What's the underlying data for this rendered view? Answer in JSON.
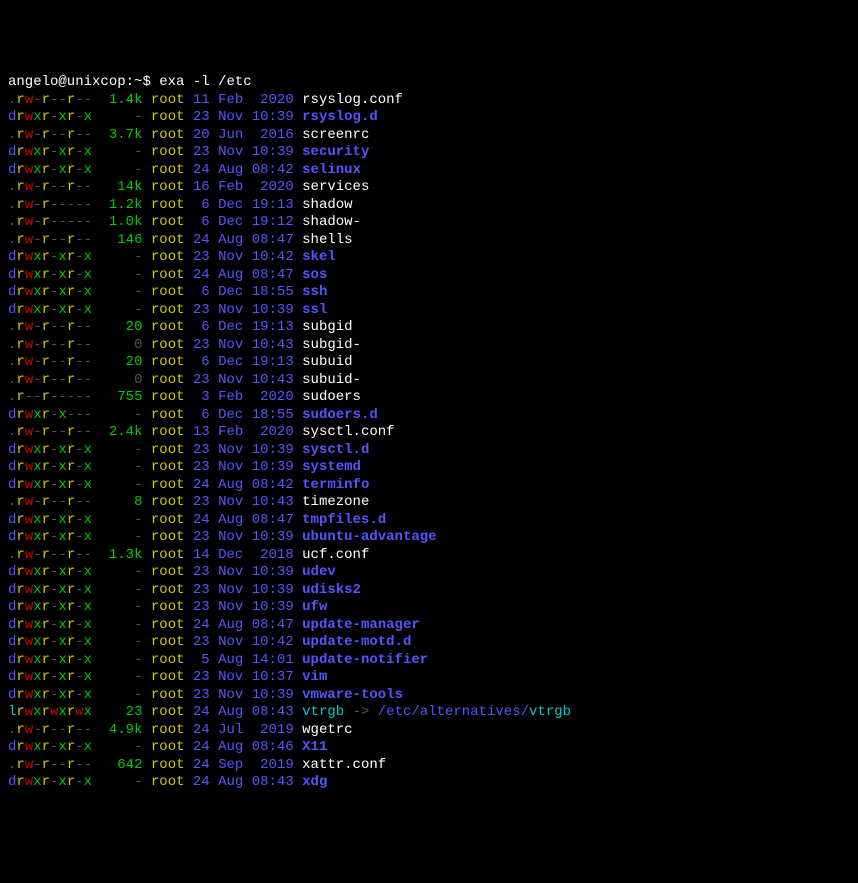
{
  "prompt": {
    "userhost": "angelo@unixcop",
    "path": "~",
    "command": "exa -l /etc"
  },
  "rows": [
    {
      "perm": ".rw-r--r--",
      "size": "1.4k",
      "user": "root",
      "day": "11",
      "mon": "Feb",
      "time": "2020",
      "name": "rsyslog.conf",
      "type": "file"
    },
    {
      "perm": "drwxr-xr-x",
      "size": "-",
      "user": "root",
      "day": "23",
      "mon": "Nov",
      "time": "10:39",
      "name": "rsyslog.d",
      "type": "dir"
    },
    {
      "perm": ".rw-r--r--",
      "size": "3.7k",
      "user": "root",
      "day": "20",
      "mon": "Jun",
      "time": "2016",
      "name": "screenrc",
      "type": "file"
    },
    {
      "perm": "drwxr-xr-x",
      "size": "-",
      "user": "root",
      "day": "23",
      "mon": "Nov",
      "time": "10:39",
      "name": "security",
      "type": "dir"
    },
    {
      "perm": "drwxr-xr-x",
      "size": "-",
      "user": "root",
      "day": "24",
      "mon": "Aug",
      "time": "08:42",
      "name": "selinux",
      "type": "dir"
    },
    {
      "perm": ".rw-r--r--",
      "size": "14k",
      "user": "root",
      "day": "16",
      "mon": "Feb",
      "time": "2020",
      "name": "services",
      "type": "file"
    },
    {
      "perm": ".rw-r-----",
      "size": "1.2k",
      "user": "root",
      "day": "6",
      "mon": "Dec",
      "time": "19:13",
      "name": "shadow",
      "type": "file"
    },
    {
      "perm": ".rw-r-----",
      "size": "1.0k",
      "user": "root",
      "day": "6",
      "mon": "Dec",
      "time": "19:12",
      "name": "shadow-",
      "type": "file"
    },
    {
      "perm": ".rw-r--r--",
      "size": "146",
      "user": "root",
      "day": "24",
      "mon": "Aug",
      "time": "08:47",
      "name": "shells",
      "type": "file"
    },
    {
      "perm": "drwxr-xr-x",
      "size": "-",
      "user": "root",
      "day": "23",
      "mon": "Nov",
      "time": "10:42",
      "name": "skel",
      "type": "dir"
    },
    {
      "perm": "drwxr-xr-x",
      "size": "-",
      "user": "root",
      "day": "24",
      "mon": "Aug",
      "time": "08:47",
      "name": "sos",
      "type": "dir"
    },
    {
      "perm": "drwxr-xr-x",
      "size": "-",
      "user": "root",
      "day": "6",
      "mon": "Dec",
      "time": "18:55",
      "name": "ssh",
      "type": "dir"
    },
    {
      "perm": "drwxr-xr-x",
      "size": "-",
      "user": "root",
      "day": "23",
      "mon": "Nov",
      "time": "10:39",
      "name": "ssl",
      "type": "dir"
    },
    {
      "perm": ".rw-r--r--",
      "size": "20",
      "user": "root",
      "day": "6",
      "mon": "Dec",
      "time": "19:13",
      "name": "subgid",
      "type": "file"
    },
    {
      "perm": ".rw-r--r--",
      "size": "0",
      "user": "root",
      "day": "23",
      "mon": "Nov",
      "time": "10:43",
      "name": "subgid-",
      "type": "file"
    },
    {
      "perm": ".rw-r--r--",
      "size": "20",
      "user": "root",
      "day": "6",
      "mon": "Dec",
      "time": "19:13",
      "name": "subuid",
      "type": "file"
    },
    {
      "perm": ".rw-r--r--",
      "size": "0",
      "user": "root",
      "day": "23",
      "mon": "Nov",
      "time": "10:43",
      "name": "subuid-",
      "type": "file"
    },
    {
      "perm": ".r--r-----",
      "size": "755",
      "user": "root",
      "day": "3",
      "mon": "Feb",
      "time": "2020",
      "name": "sudoers",
      "type": "file"
    },
    {
      "perm": "drwxr-x---",
      "size": "-",
      "user": "root",
      "day": "6",
      "mon": "Dec",
      "time": "18:55",
      "name": "sudoers.d",
      "type": "dir"
    },
    {
      "perm": ".rw-r--r--",
      "size": "2.4k",
      "user": "root",
      "day": "13",
      "mon": "Feb",
      "time": "2020",
      "name": "sysctl.conf",
      "type": "file"
    },
    {
      "perm": "drwxr-xr-x",
      "size": "-",
      "user": "root",
      "day": "23",
      "mon": "Nov",
      "time": "10:39",
      "name": "sysctl.d",
      "type": "dir"
    },
    {
      "perm": "drwxr-xr-x",
      "size": "-",
      "user": "root",
      "day": "23",
      "mon": "Nov",
      "time": "10:39",
      "name": "systemd",
      "type": "dir"
    },
    {
      "perm": "drwxr-xr-x",
      "size": "-",
      "user": "root",
      "day": "24",
      "mon": "Aug",
      "time": "08:42",
      "name": "terminfo",
      "type": "dir"
    },
    {
      "perm": ".rw-r--r--",
      "size": "8",
      "user": "root",
      "day": "23",
      "mon": "Nov",
      "time": "10:43",
      "name": "timezone",
      "type": "file"
    },
    {
      "perm": "drwxr-xr-x",
      "size": "-",
      "user": "root",
      "day": "24",
      "mon": "Aug",
      "time": "08:47",
      "name": "tmpfiles.d",
      "type": "dir"
    },
    {
      "perm": "drwxr-xr-x",
      "size": "-",
      "user": "root",
      "day": "23",
      "mon": "Nov",
      "time": "10:39",
      "name": "ubuntu-advantage",
      "type": "dir"
    },
    {
      "perm": ".rw-r--r--",
      "size": "1.3k",
      "user": "root",
      "day": "14",
      "mon": "Dec",
      "time": "2018",
      "name": "ucf.conf",
      "type": "file"
    },
    {
      "perm": "drwxr-xr-x",
      "size": "-",
      "user": "root",
      "day": "23",
      "mon": "Nov",
      "time": "10:39",
      "name": "udev",
      "type": "dir"
    },
    {
      "perm": "drwxr-xr-x",
      "size": "-",
      "user": "root",
      "day": "23",
      "mon": "Nov",
      "time": "10:39",
      "name": "udisks2",
      "type": "dir"
    },
    {
      "perm": "drwxr-xr-x",
      "size": "-",
      "user": "root",
      "day": "23",
      "mon": "Nov",
      "time": "10:39",
      "name": "ufw",
      "type": "dir"
    },
    {
      "perm": "drwxr-xr-x",
      "size": "-",
      "user": "root",
      "day": "24",
      "mon": "Aug",
      "time": "08:47",
      "name": "update-manager",
      "type": "dir"
    },
    {
      "perm": "drwxr-xr-x",
      "size": "-",
      "user": "root",
      "day": "23",
      "mon": "Nov",
      "time": "10:42",
      "name": "update-motd.d",
      "type": "dir"
    },
    {
      "perm": "drwxr-xr-x",
      "size": "-",
      "user": "root",
      "day": "5",
      "mon": "Aug",
      "time": "14:01",
      "name": "update-notifier",
      "type": "dir"
    },
    {
      "perm": "drwxr-xr-x",
      "size": "-",
      "user": "root",
      "day": "23",
      "mon": "Nov",
      "time": "10:37",
      "name": "vim",
      "type": "dir"
    },
    {
      "perm": "drwxr-xr-x",
      "size": "-",
      "user": "root",
      "day": "23",
      "mon": "Nov",
      "time": "10:39",
      "name": "vmware-tools",
      "type": "dir"
    },
    {
      "perm": "lrwxrwxrwx",
      "size": "23",
      "user": "root",
      "day": "24",
      "mon": "Aug",
      "time": "08:43",
      "name": "vtrgb",
      "type": "link",
      "link": "/etc/alternatives/vtrgb"
    },
    {
      "perm": ".rw-r--r--",
      "size": "4.9k",
      "user": "root",
      "day": "24",
      "mon": "Jul",
      "time": "2019",
      "name": "wgetrc",
      "type": "file"
    },
    {
      "perm": "drwxr-xr-x",
      "size": "-",
      "user": "root",
      "day": "24",
      "mon": "Aug",
      "time": "08:46",
      "name": "X11",
      "type": "dir"
    },
    {
      "perm": ".rw-r--r--",
      "size": "642",
      "user": "root",
      "day": "24",
      "mon": "Sep",
      "time": "2019",
      "name": "xattr.conf",
      "type": "file"
    },
    {
      "perm": "drwxr-xr-x",
      "size": "-",
      "user": "root",
      "day": "24",
      "mon": "Aug",
      "time": "08:43",
      "name": "xdg",
      "type": "dir"
    }
  ]
}
